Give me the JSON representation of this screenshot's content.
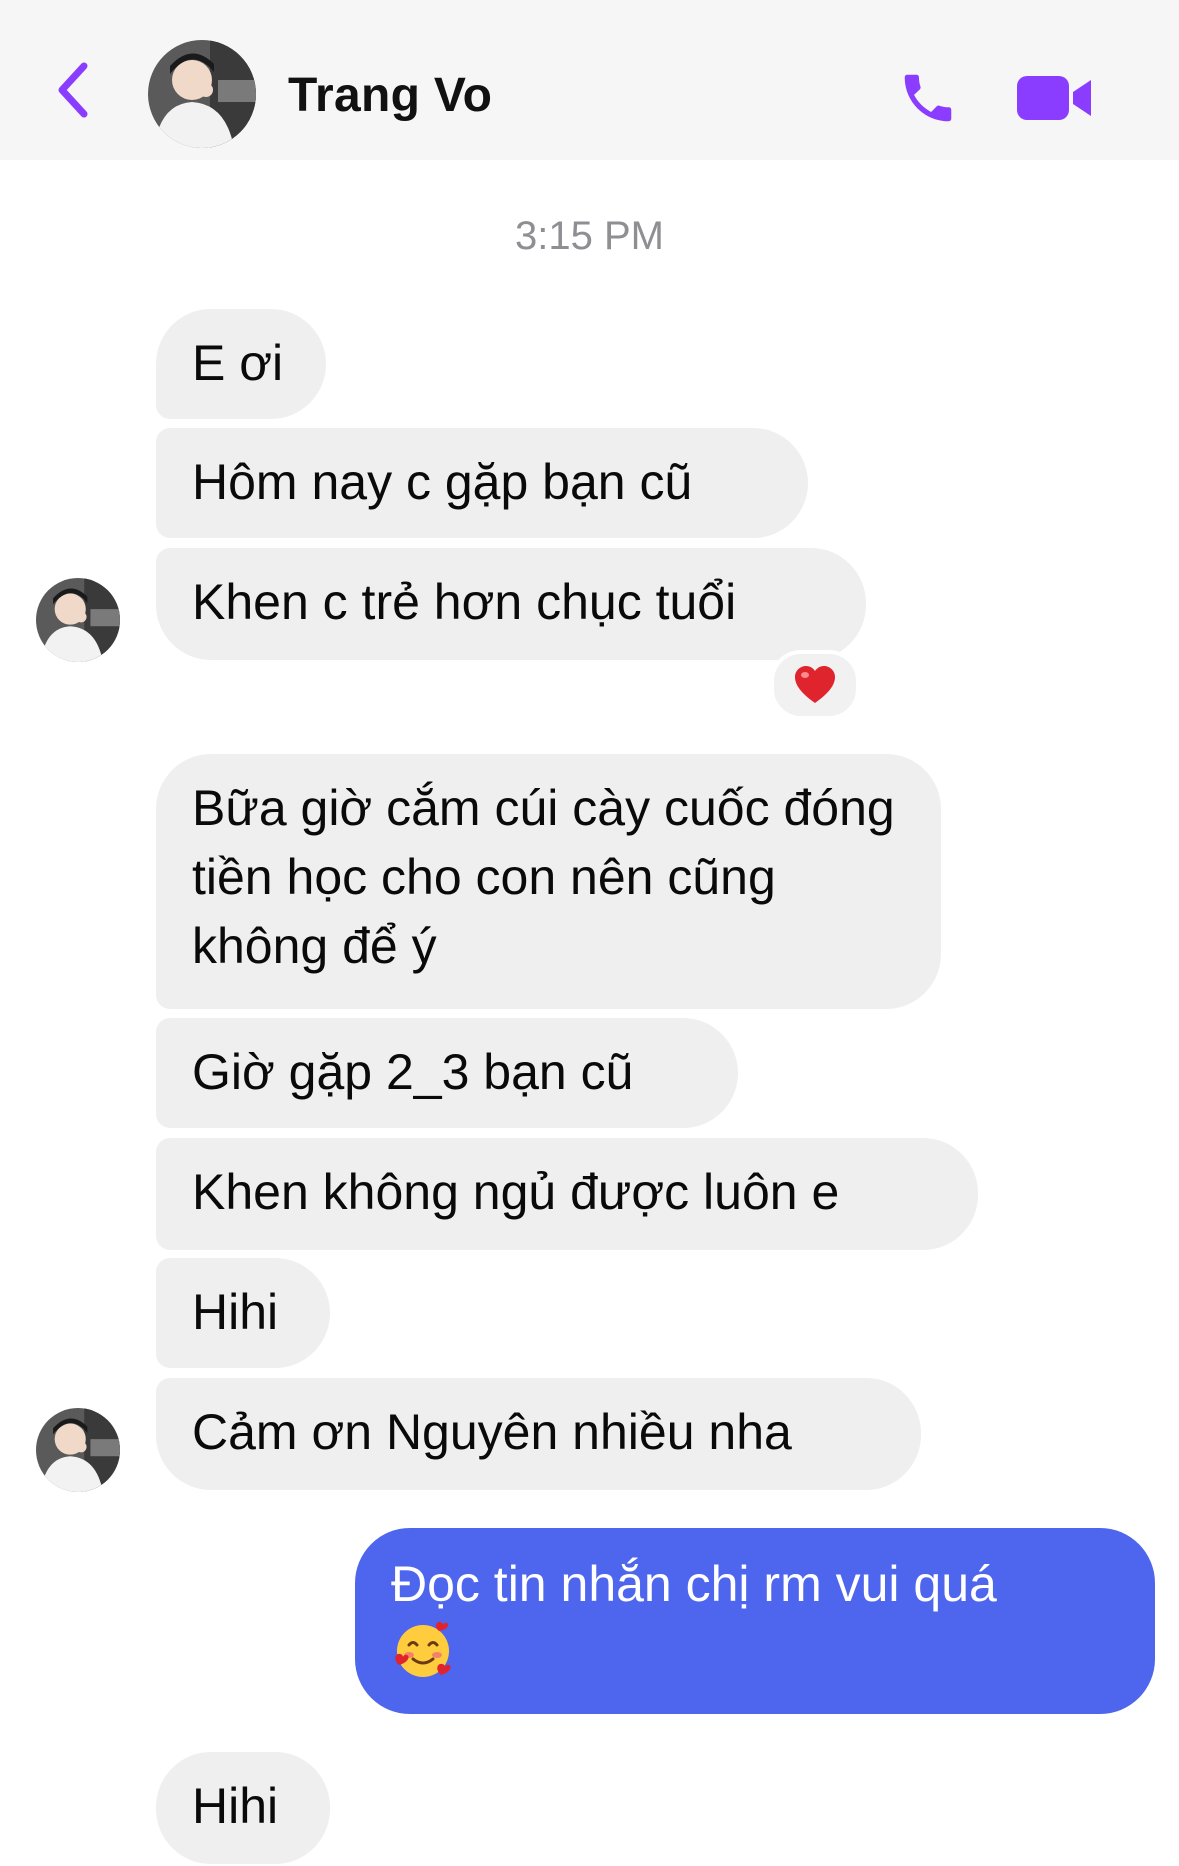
{
  "header": {
    "contact_name": "Trang Vo",
    "accent_color": "#8b3dff",
    "back_icon": "chevron-left-icon",
    "call_icon": "phone-icon",
    "video_icon": "video-camera-icon"
  },
  "conversation": {
    "timestamp": "3:15 PM",
    "messages": [
      {
        "sender": "contact",
        "text": "E ơi"
      },
      {
        "sender": "contact",
        "text": "Hôm nay c gặp bạn cũ"
      },
      {
        "sender": "contact",
        "text": "Khen c trẻ hơn chục tuổi",
        "reaction": "heart-emoji"
      },
      {
        "sender": "contact",
        "text": "Bữa giờ cắm cúi cày cuốc đóng tiền học cho con nên cũng không để ý"
      },
      {
        "sender": "contact",
        "text": "Giờ gặp 2_3 bạn cũ"
      },
      {
        "sender": "contact",
        "text": "Khen không ngủ được luôn e"
      },
      {
        "sender": "contact",
        "text": "Hihi"
      },
      {
        "sender": "contact",
        "text": "Cảm ơn Nguyên nhiều nha"
      },
      {
        "sender": "me",
        "text": "Đọc tin nhắn chị rm vui quá",
        "emoji": "smiling-face-with-hearts-emoji"
      },
      {
        "sender": "contact",
        "text": "Hihi"
      }
    ]
  },
  "colors": {
    "incoming_bubble": "#efefef",
    "outgoing_bubble": "#4e66ee",
    "header_background": "#f6f6f6"
  }
}
